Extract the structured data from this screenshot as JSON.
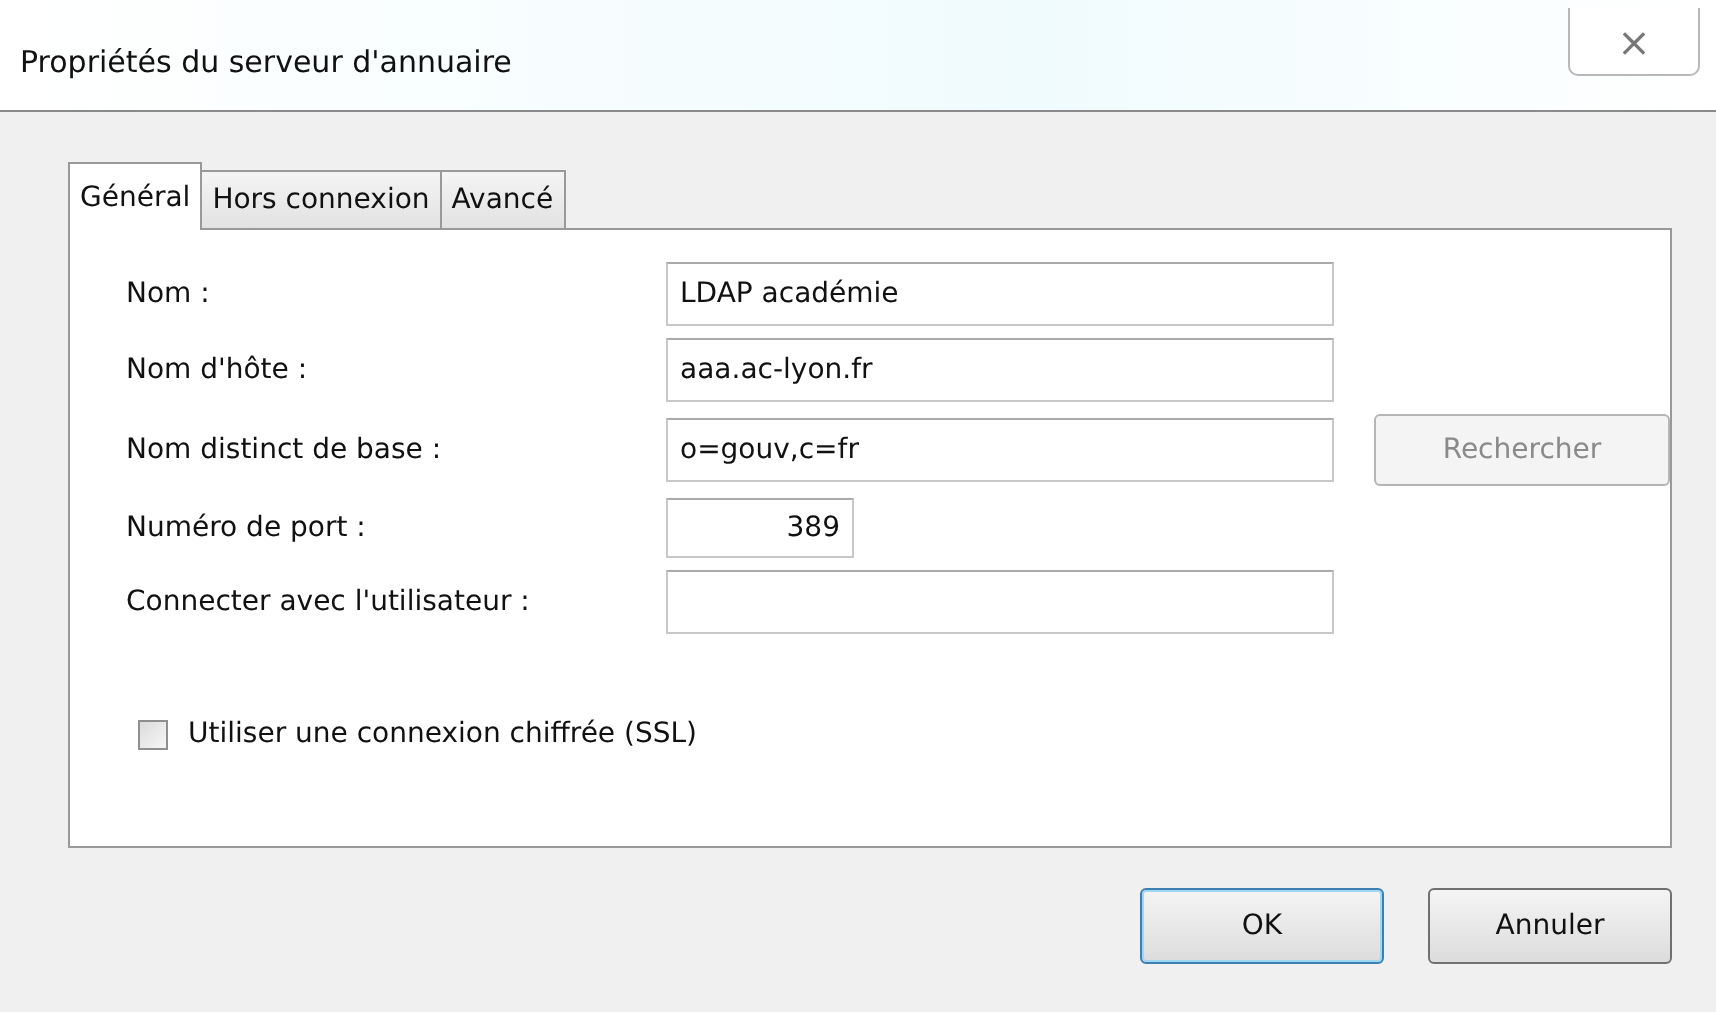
{
  "window": {
    "title": "Propriétés du serveur d'annuaire",
    "close": "×"
  },
  "tabs": [
    {
      "label": "Général",
      "selected": true
    },
    {
      "label": "Hors connexion",
      "selected": false
    },
    {
      "label": "Avancé",
      "selected": false
    }
  ],
  "fields": [
    {
      "label": "Nom :",
      "value": "LDAP académie",
      "kind": "wide"
    },
    {
      "label": "Nom d'hôte :",
      "value": "aaa.ac-lyon.fr",
      "kind": "wide"
    },
    {
      "label": "Nom distinct de base :",
      "value": "o=gouv,c=fr",
      "kind": "wide",
      "button": {
        "label": "Rechercher",
        "disabled": true
      }
    },
    {
      "label": "Numéro de port :",
      "value": "389",
      "kind": "number"
    },
    {
      "label": "Connecter avec l'utilisateur :",
      "kind": "wide"
    }
  ],
  "ssl": {
    "label": "Utiliser une connexion chiffrée (SSL)",
    "checked": false
  },
  "buttons": [
    {
      "label": "OK",
      "selected": true
    },
    {
      "label": "Annuler",
      "selected": false
    }
  ]
}
